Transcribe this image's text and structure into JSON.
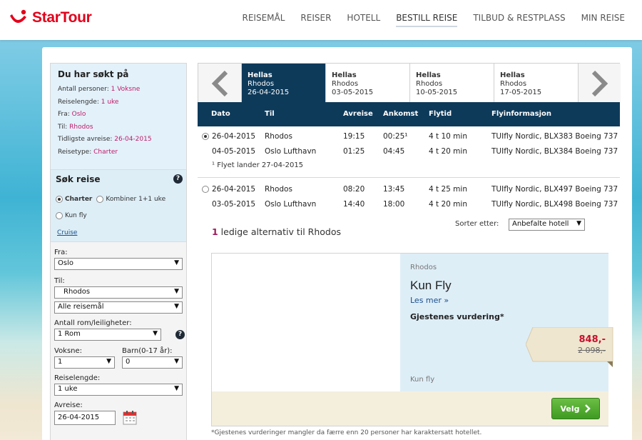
{
  "header": {
    "logo_text": "StarTour",
    "nav": [
      "REISEMÅL",
      "REISER",
      "HOTELL",
      "BESTILL REISE",
      "TILBUD & RESTPLASS",
      "MIN REISE"
    ],
    "active_nav": "BESTILL REISE"
  },
  "summary": {
    "title": "Du har søkt på",
    "rows": [
      {
        "label": "Antall personer:",
        "value": "1 Voksne"
      },
      {
        "label": "Reiselengde:",
        "value": "1 uke"
      },
      {
        "label": "Fra:",
        "value": "Oslo"
      },
      {
        "label": "Til:",
        "value": "Rhodos"
      },
      {
        "label": "Tidligste avreise:",
        "value": "26-04-2015"
      },
      {
        "label": "Reisetype:",
        "value": "Charter"
      }
    ]
  },
  "search": {
    "title": "Søk reise",
    "options": {
      "charter": "Charter",
      "combine": "Kombiner 1+1 uke",
      "flight_only": "Kun fly"
    },
    "selected": "Charter",
    "cruise_link": "Cruise",
    "from_label": "Fra:",
    "from_value": "Oslo",
    "to_label": "Til:",
    "to_value": "Rhodos",
    "to_sub_value": "Alle reisemål",
    "rooms_label": "Antall rom/leiligheter:",
    "rooms_value": "1 Rom",
    "adults_label": "Voksne:",
    "adults_value": "1",
    "children_label": "Barn(0-17 år):",
    "children_value": "0",
    "length_label": "Reiselengde:",
    "length_value": "1 uke",
    "depart_label": "Avreise:",
    "depart_value": "26-04-2015"
  },
  "date_tabs": [
    {
      "country": "Hellas",
      "place": "Rhodos",
      "date": "26-04-2015",
      "active": true
    },
    {
      "country": "Hellas",
      "place": "Rhodos",
      "date": "03-05-2015",
      "active": false
    },
    {
      "country": "Hellas",
      "place": "Rhodos",
      "date": "10-05-2015",
      "active": false
    },
    {
      "country": "Hellas",
      "place": "Rhodos",
      "date": "17-05-2015",
      "active": false
    }
  ],
  "flight_columns": [
    "Dato",
    "Til",
    "Avreise",
    "Ankomst",
    "Flytid",
    "Flyinformasjon"
  ],
  "flight_options": [
    {
      "selected": true,
      "legs": [
        {
          "date": "26-04-2015",
          "to": "Rhodos",
          "depart": "19:15",
          "arrive": "00:25¹",
          "duration": "4 t 10 min",
          "info": "TUIfly Nordic, BLX383 Boeing 737"
        },
        {
          "date": "04-05-2015",
          "to": "Oslo Lufthavn",
          "depart": "01:25",
          "arrive": "04:45",
          "duration": "4 t 20 min",
          "info": "TUIfly Nordic, BLX384 Boeing 737"
        }
      ],
      "footnote": "¹ Flyet lander 27-04-2015"
    },
    {
      "selected": false,
      "legs": [
        {
          "date": "26-04-2015",
          "to": "Rhodos",
          "depart": "08:20",
          "arrive": "13:45",
          "duration": "4 t 25 min",
          "info": "TUIfly Nordic, BLX497 Boeing 737"
        },
        {
          "date": "03-05-2015",
          "to": "Oslo Lufthavn",
          "depart": "14:40",
          "arrive": "18:00",
          "duration": "4 t 20 min",
          "info": "TUIfly Nordic, BLX498 Boeing 737"
        }
      ],
      "footnote": ""
    }
  ],
  "alternatives": {
    "count": "1",
    "text": " ledige alternativ til Rhodos",
    "sort_label": "Sorter etter:",
    "sort_value": "Anbefalte hotell"
  },
  "result": {
    "region": "Rhodos",
    "title": "Kun Fly",
    "more_link": "Les mer »",
    "rating_label": "Gjestenes vurdering*",
    "type": "Kun fly",
    "price": "848,-",
    "old_price": "2 098,-",
    "button": "Velg"
  },
  "disclaimer": "*Gjestenes vurderinger mangler da færre enn 20 personer har karaktersatt hotellet.",
  "colors": {
    "brand": "#e2001a",
    "accent": "#0e3a5a",
    "highlight": "#c01c6a",
    "price": "#c8102e",
    "button": "#4caf2c"
  }
}
